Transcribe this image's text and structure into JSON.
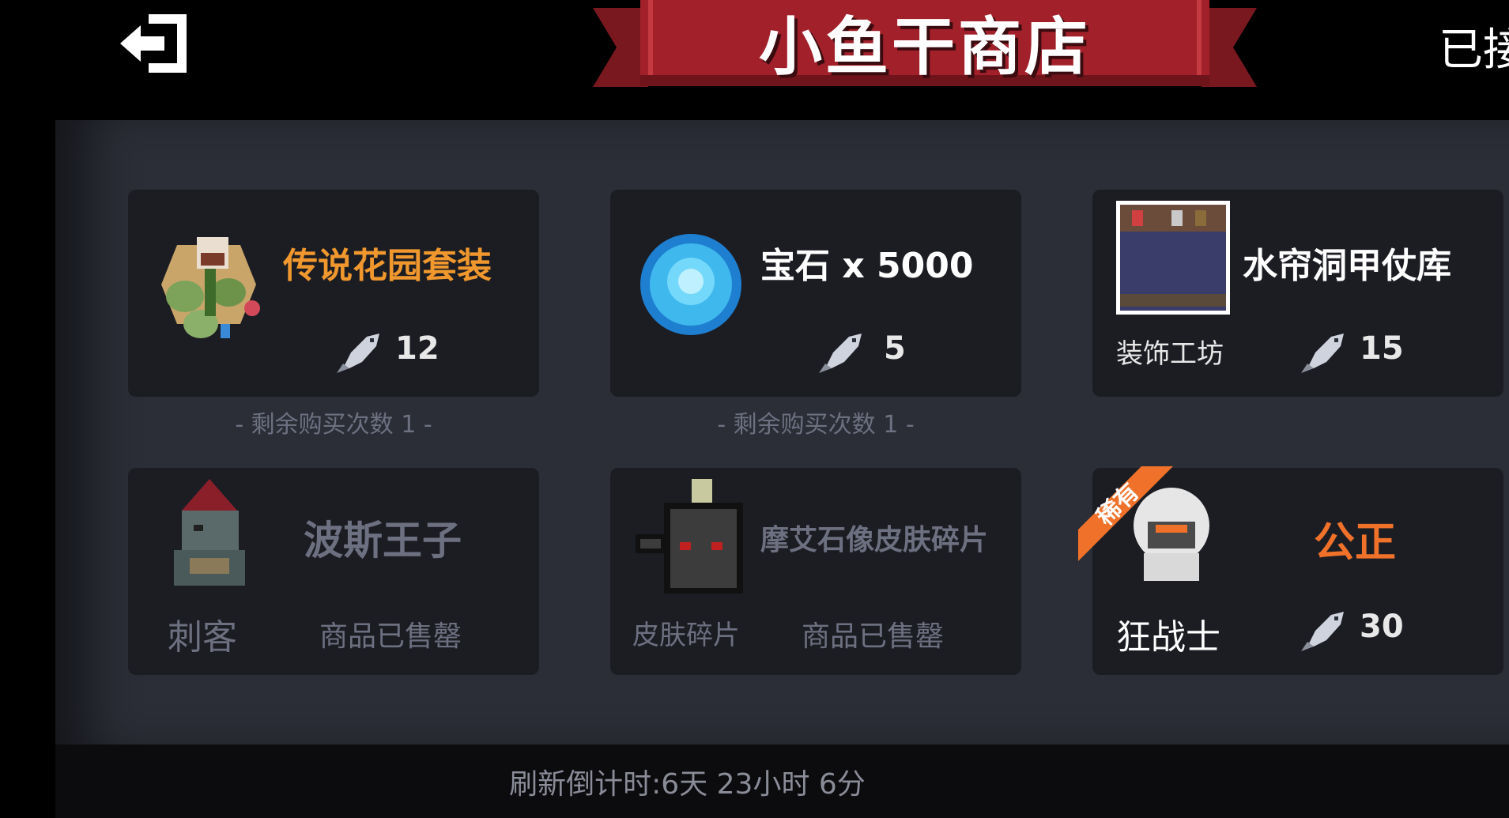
{
  "header": {
    "title": "小鱼干商店",
    "top_right_text": "已接"
  },
  "shop_items": [
    {
      "name": "传说花园套装",
      "price": "12",
      "remaining_label": "- 剩余购买次数 1 -",
      "name_color": "#f0982e"
    },
    {
      "name": "宝石 x 5000",
      "price": "5",
      "remaining_label": "- 剩余购买次数 1 -",
      "name_color": "#ffffff"
    },
    {
      "name": "水帘洞甲仗库",
      "category": "装饰工坊",
      "price": "15",
      "name_color": "#ffffff"
    },
    {
      "name": "波斯王子",
      "category": "刺客",
      "status": "商品已售罄",
      "name_color": "#6d7080"
    },
    {
      "name": "摩艾石像皮肤碎片",
      "category": "皮肤碎片",
      "status": "商品已售罄",
      "name_color": "#6d7080"
    },
    {
      "name": "公正",
      "category": "狂战士",
      "price": "30",
      "badge": "稀有",
      "name_color": "#f0722a"
    }
  ],
  "footer": {
    "refresh_countdown": "刷新倒计时:6天 23小时 6分"
  },
  "colors": {
    "ribbon": "#a1202a",
    "panel": "#2b2e37",
    "card": "#1c1d23",
    "legendary": "#f0982e",
    "rare": "#f0722a"
  },
  "icons": [
    "exit-icon",
    "fish-currency-icon",
    "gem-icon",
    "garden-set-icon",
    "armory-thumbnail",
    "prince-of-persia-icon",
    "moai-statue-icon",
    "berserker-icon"
  ]
}
